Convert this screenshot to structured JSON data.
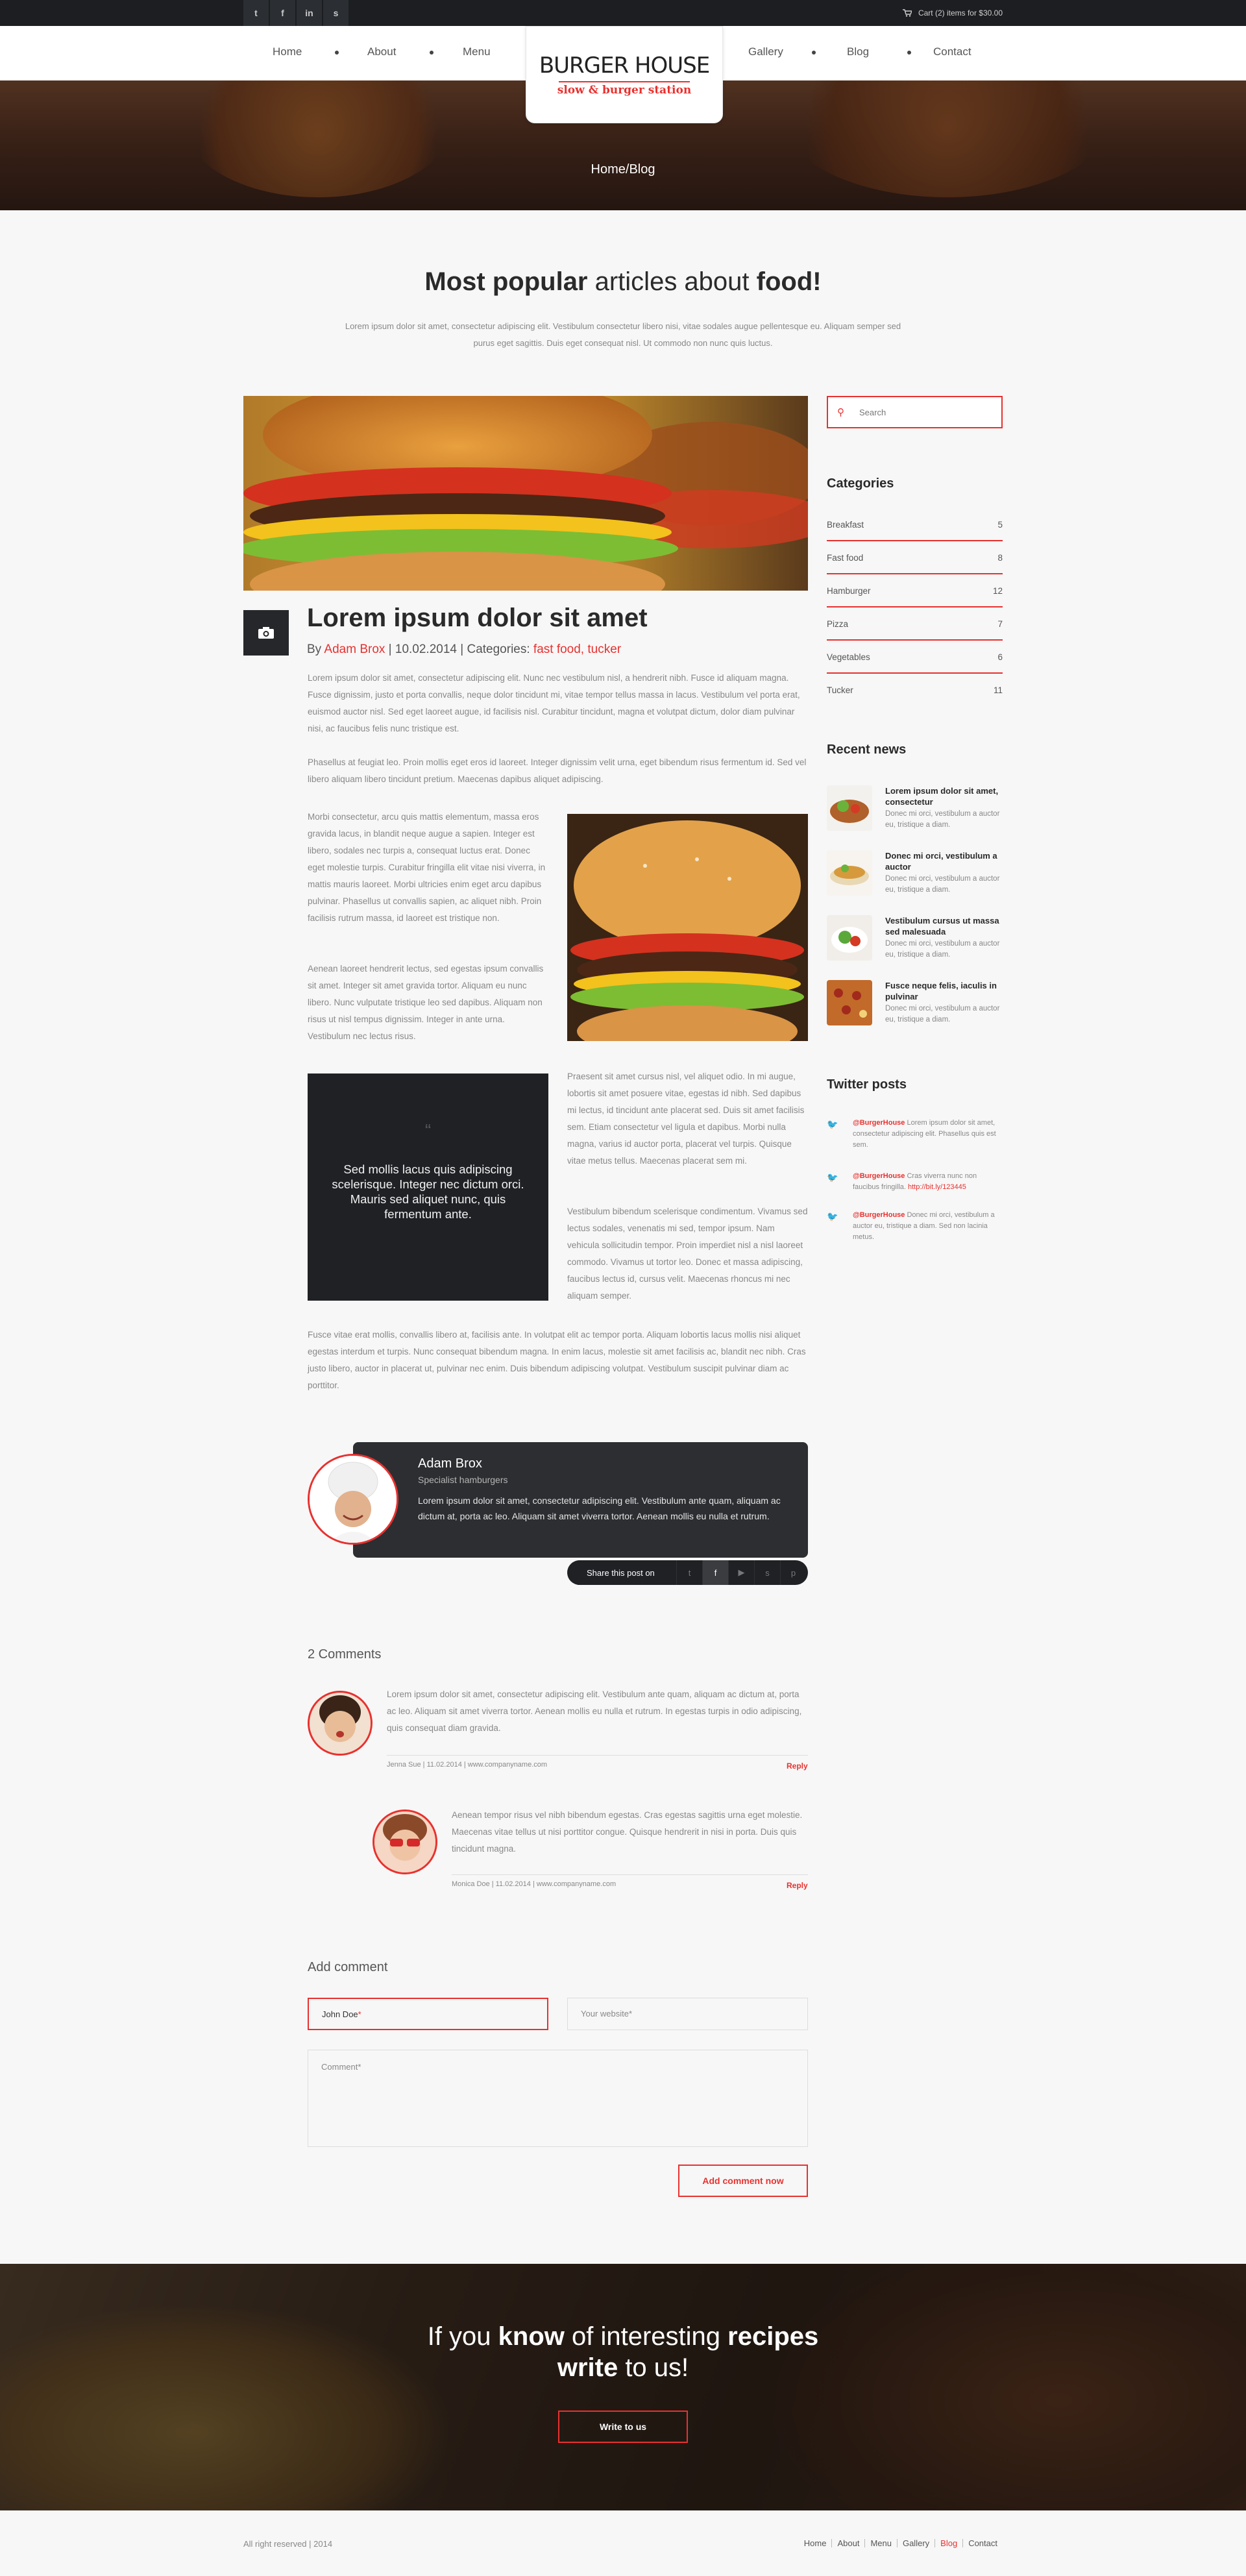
{
  "topbar": {
    "social": [
      "twitter-icon",
      "facebook-icon",
      "linkedin-icon",
      "skype-icon"
    ],
    "social_glyphs": [
      "t",
      "f",
      "in",
      "s"
    ],
    "cart": "Cart (2) items for $30.00"
  },
  "nav": {
    "left": [
      "Home",
      "About",
      "Menu"
    ],
    "right": [
      "Gallery",
      "Blog",
      "Contact"
    ],
    "active": "Home"
  },
  "logo": {
    "title": "BURGER HOUSE",
    "tagline": "slow & burger station"
  },
  "hero": {
    "breadcrumb": "Home/Blog"
  },
  "headline": {
    "p1": "Most popular",
    "p2": " articles about ",
    "p3": "food!"
  },
  "intro": "Lorem ipsum dolor sit amet, consectetur adipiscing elit. Vestibulum consectetur libero nisi, vitae sodales augue pellentesque eu. Aliquam semper sed purus eget sagittis. Duis eget consequat nisl. Ut commodo non nunc quis luctus.",
  "post": {
    "title": "Lorem ipsum dolor sit amet",
    "by": "By ",
    "author": "Adam Brox",
    "date": " | 10.02.2014 | Categories: ",
    "cats": "fast food, tucker",
    "p1": "Lorem ipsum dolor sit amet, consectetur adipiscing elit. Nunc nec vestibulum nisl, a hendrerit nibh. Fusce id aliquam magna. Fusce dignissim, justo et porta convallis, neque dolor tincidunt mi, vitae tempor tellus massa in lacus. Vestibulum vel porta erat, euismod auctor nisl. Sed eget laoreet augue, id facilisis nisl. Curabitur tincidunt, magna et volutpat dictum, dolor diam pulvinar nisi, ac faucibus felis nunc tristique est.",
    "p2": "Phasellus at feugiat leo. Proin mollis eget eros id laoreet. Integer dignissim velit urna, eget bibendum risus fermentum id. Sed vel libero aliquam libero tincidunt pretium. Maecenas dapibus aliquet adipiscing.",
    "p3": "Morbi consectetur, arcu quis mattis elementum, massa eros gravida lacus, in blandit neque augue a sapien. Integer est libero, sodales nec turpis a, consequat luctus erat. Donec eget molestie turpis. Curabitur fringilla elit vitae nisi viverra, in mattis mauris laoreet. Morbi ultricies enim eget arcu dapibus pulvinar. Phasellus ut convallis sapien, ac aliquet nibh. Proin facilisis rutrum massa, id laoreet est tristique non.",
    "p4": "Aenean laoreet hendrerit lectus, sed egestas ipsum convallis sit amet. Integer sit amet gravida tortor. Aliquam eu nunc libero. Nunc vulputate tristique leo sed dapibus. Aliquam non risus ut nisl tempus dignissim. Integer in ante urna. Vestibulum nec lectus risus.",
    "quote": "Sed mollis lacus quis adipiscing scelerisque. Integer nec dictum orci. Mauris sed aliquet nunc, quis fermentum ante.",
    "p5": "Praesent sit amet cursus nisl, vel aliquet odio. In mi augue, lobortis sit amet posuere vitae, egestas id nibh. Sed dapibus mi lectus, id tincidunt ante placerat sed. Duis sit amet facilisis sem. Etiam consectetur vel ligula et dapibus. Morbi nulla magna, varius id auctor porta, placerat vel turpis. Quisque vitae metus tellus. Maecenas placerat sem mi.",
    "p6": "Vestibulum bibendum scelerisque condimentum. Vivamus sed lectus sodales, venenatis mi sed, tempor ipsum. Nam vehicula sollicitudin tempor. Proin imperdiet nisl a nisl laoreet commodo. Vivamus ut tortor leo. Donec et massa adipiscing, faucibus lectus id, cursus velit. Maecenas rhoncus mi nec aliquam semper.",
    "p7": "Fusce vitae erat mollis, convallis libero at, facilisis ante. In volutpat elit ac tempor porta. Aliquam lobortis lacus mollis nisi aliquet egestas interdum et turpis. Nunc consequat bibendum magna. In enim lacus, molestie sit amet facilisis ac, blandit nec nibh. Cras justo libero, auctor in placerat ut, pulvinar nec enim. Duis bibendum adipiscing volutpat. Vestibulum suscipit pulvinar diam ac porttitor."
  },
  "author_box": {
    "name": "Adam Brox",
    "role": "Specialist hamburgers",
    "bio": "Lorem ipsum dolor sit amet, consectetur adipiscing elit. Vestibulum ante quam, aliquam ac dictum at, porta ac leo. Aliquam sit amet viverra tortor. Aenean mollis eu nulla et rutrum.",
    "share_label": "Share this post on",
    "share_icons": [
      "twitter-icon",
      "facebook-icon",
      "youtube-icon",
      "skype-icon",
      "pinterest-icon"
    ],
    "share_glyphs": [
      "t",
      "f",
      "▶",
      "s",
      "p"
    ]
  },
  "comments": {
    "count": "2 Comments",
    "items": [
      {
        "text": "Lorem ipsum dolor sit amet, consectetur adipiscing elit. Vestibulum ante quam, aliquam ac dictum at, porta ac leo. Aliquam sit amet viverra tortor. Aenean mollis eu nulla et rutrum. In egestas turpis in odio adipiscing, quis consequat diam gravida.",
        "meta": "Jenna Sue | 11.02.2014 | www.companyname.com",
        "reply": "Reply"
      },
      {
        "text": "Aenean tempor risus vel nibh bibendum egestas. Cras egestas sagittis urna eget molestie. Maecenas vitae tellus ut nisi porttitor congue. Quisque hendrerit in nisi in porta. Duis quis tincidunt magna.",
        "meta": "Monica Doe | 11.02.2014 | www.companyname.com",
        "reply": "Reply"
      }
    ]
  },
  "add_comment": {
    "title": "Add comment",
    "name_value": "John Doe",
    "name_star": "*",
    "website_ph": "Your website*",
    "comment_ph": "Comment*",
    "submit": "Add comment now"
  },
  "sidebar": {
    "search_ph": "Search",
    "categories_title": "Categories",
    "categories": [
      {
        "name": "Breakfast",
        "count": "5"
      },
      {
        "name": "Fast food",
        "count": "8"
      },
      {
        "name": "Hamburger",
        "count": "12"
      },
      {
        "name": "Pizza",
        "count": "7"
      },
      {
        "name": "Vegetables",
        "count": "6"
      },
      {
        "name": "Tucker",
        "count": "11"
      }
    ],
    "news_title": "Recent news",
    "news": [
      {
        "title": "Lorem ipsum dolor sit amet, consectetur",
        "body": "Donec mi orci, vestibulum a auctor eu, tristique a diam."
      },
      {
        "title": "Donec mi orci, vestibulum a auctor",
        "body": "Donec mi orci, vestibulum a auctor eu, tristique a diam."
      },
      {
        "title": "Vestibulum cursus ut massa sed malesuada",
        "body": "Donec mi orci, vestibulum a auctor eu, tristique a diam."
      },
      {
        "title": "Fusce neque felis, iaculis in pulvinar",
        "body": "Donec mi orci, vestibulum a auctor eu, tristique a diam."
      }
    ],
    "twitter_title": "Twitter posts",
    "tweets": [
      {
        "handle": "@BurgerHouse",
        "text": " Lorem ipsum dolor sit amet, consectetur adipiscing elit. Phasellus quis est sem.",
        "link": ""
      },
      {
        "handle": "@BurgerHouse",
        "text": " Cras viverra nunc non faucibus fringilla. ",
        "link": "http://bit.ly/123445"
      },
      {
        "handle": "@BurgerHouse",
        "text": " Donec mi orci, vestibulum a auctor eu, tristique a diam. Sed non lacinia metus.",
        "link": ""
      }
    ]
  },
  "banner": {
    "a": "If you ",
    "b": "know",
    "c": " of interesting ",
    "d": "recipes",
    "e": "write",
    "f": " to us!",
    "button": "Write to us"
  },
  "footer": {
    "copy": "All right reserved | 2014",
    "links": [
      "Home",
      "About",
      "Menu",
      "Gallery",
      "Blog",
      "Contact"
    ],
    "active": "Blog"
  },
  "colors": {
    "accent": "#e8312f",
    "dark": "#1f2125",
    "bg": "#f7f7f7"
  }
}
